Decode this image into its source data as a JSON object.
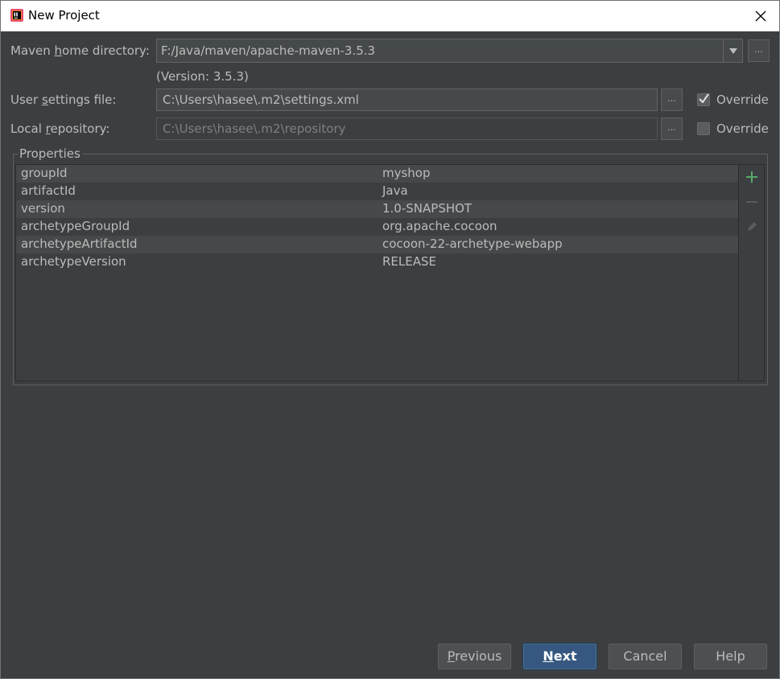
{
  "window": {
    "title": "New Project"
  },
  "maven": {
    "home_label_pre": "Maven ",
    "home_label_mnemonic": "h",
    "home_label_post": "ome directory:",
    "home_value": "F:/Java/maven/apache-maven-3.5.3",
    "version_text": "(Version: 3.5.3)",
    "settings_label_pre": "User ",
    "settings_label_mnemonic": "s",
    "settings_label_post": "ettings file:",
    "settings_value": "C:\\Users\\hasee\\.m2\\settings.xml",
    "repo_label_pre": "Local ",
    "repo_label_mnemonic": "r",
    "repo_label_post": "epository:",
    "repo_value": "C:\\Users\\hasee\\.m2\\repository",
    "browse_label": "...",
    "override_label": "Override",
    "settings_override_checked": true,
    "repo_override_checked": false
  },
  "properties": {
    "title": "Properties",
    "rows": [
      {
        "key": "groupId",
        "value": "myshop"
      },
      {
        "key": "artifactId",
        "value": "Java"
      },
      {
        "key": "version",
        "value": "1.0-SNAPSHOT"
      },
      {
        "key": "archetypeGroupId",
        "value": "org.apache.cocoon"
      },
      {
        "key": "archetypeArtifactId",
        "value": "cocoon-22-archetype-webapp"
      },
      {
        "key": "archetypeVersion",
        "value": "RELEASE"
      }
    ]
  },
  "buttons": {
    "previous_mnemonic": "P",
    "previous_rest": "revious",
    "next_mnemonic": "N",
    "next_rest": "ext",
    "cancel": "Cancel",
    "help": "Help"
  },
  "colors": {
    "background": "#3c3f41",
    "add_icon": "#59a869",
    "accent_button": "#365880"
  },
  "icons": {
    "app": "intellij-icon",
    "close": "close-icon",
    "combo": "dropdown-arrow-icon",
    "add": "plus-icon",
    "remove": "minus-icon",
    "edit": "pencil-icon"
  }
}
